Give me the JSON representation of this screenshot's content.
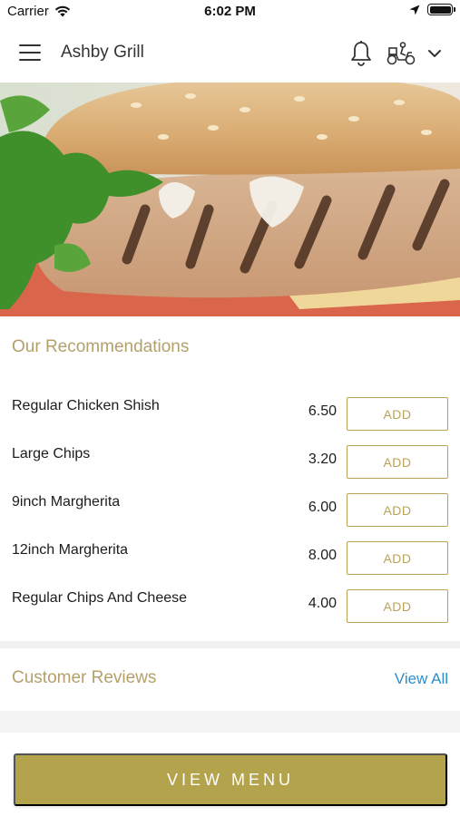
{
  "status_bar": {
    "carrier": "Carrier",
    "time": "6:02 PM",
    "icons": [
      "wifi-icon",
      "location-arrow-icon",
      "battery-icon"
    ]
  },
  "header": {
    "title": "Ashby Grill",
    "icons": [
      "menu-icon",
      "bell-icon",
      "delivery-scooter-icon",
      "chevron-down-icon"
    ]
  },
  "hero": {
    "image": "grilled-chicken-burger-photo"
  },
  "recommendations": {
    "title": "Our Recommendations",
    "items": [
      {
        "name": "Regular Chicken Shish",
        "price": "6.50",
        "button": "ADD"
      },
      {
        "name": "Large Chips",
        "price": "3.20",
        "button": "ADD"
      },
      {
        "name": "9inch Margherita",
        "price": "6.00",
        "button": "ADD"
      },
      {
        "name": "12inch Margherita",
        "price": "8.00",
        "button": "ADD"
      },
      {
        "name": "Regular Chips And Cheese",
        "price": "4.00",
        "button": "ADD"
      }
    ]
  },
  "reviews": {
    "title": "Customer Reviews",
    "view_all": "View All"
  },
  "footer": {
    "view_menu": "VIEW MENU"
  },
  "colors": {
    "accent_gold": "#b3a34c",
    "section_title": "#b3a06a",
    "link_blue": "#2a8fcf"
  }
}
